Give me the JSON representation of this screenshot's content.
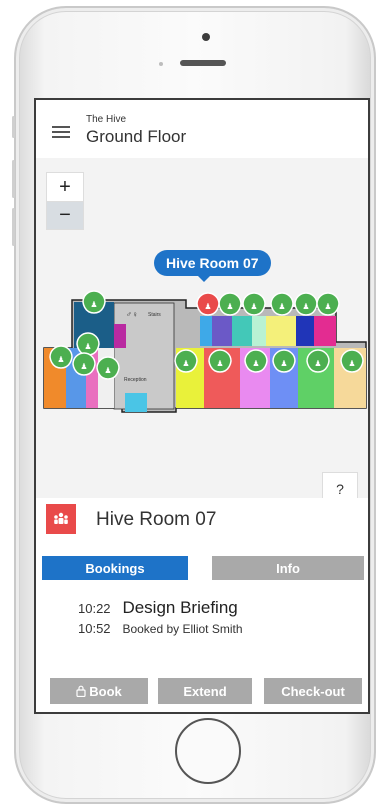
{
  "header": {
    "building": "The Hive",
    "floor": "Ground Floor"
  },
  "map": {
    "zoom_in": "+",
    "zoom_out": "−",
    "selected_tooltip": "Hive Room 07",
    "help_label": "?",
    "labels": {
      "stairs": "Stairs",
      "reception": "Reception"
    }
  },
  "room": {
    "name": "Hive Room 07",
    "icon": "meeting-room-icon",
    "accent": "#e94a4a"
  },
  "tabs": {
    "bookings": "Bookings",
    "info": "Info"
  },
  "booking": {
    "start": "10:22",
    "end": "10:52",
    "title": "Design Briefing",
    "booked_by": "Booked by Elliot Smith"
  },
  "actions": {
    "book": "Book",
    "extend": "Extend",
    "checkout": "Check-out"
  },
  "colors": {
    "primary": "#1e73c8",
    "available": "#4caf50",
    "occupied": "#e94a4a",
    "disabled": "#a9a9a9"
  }
}
